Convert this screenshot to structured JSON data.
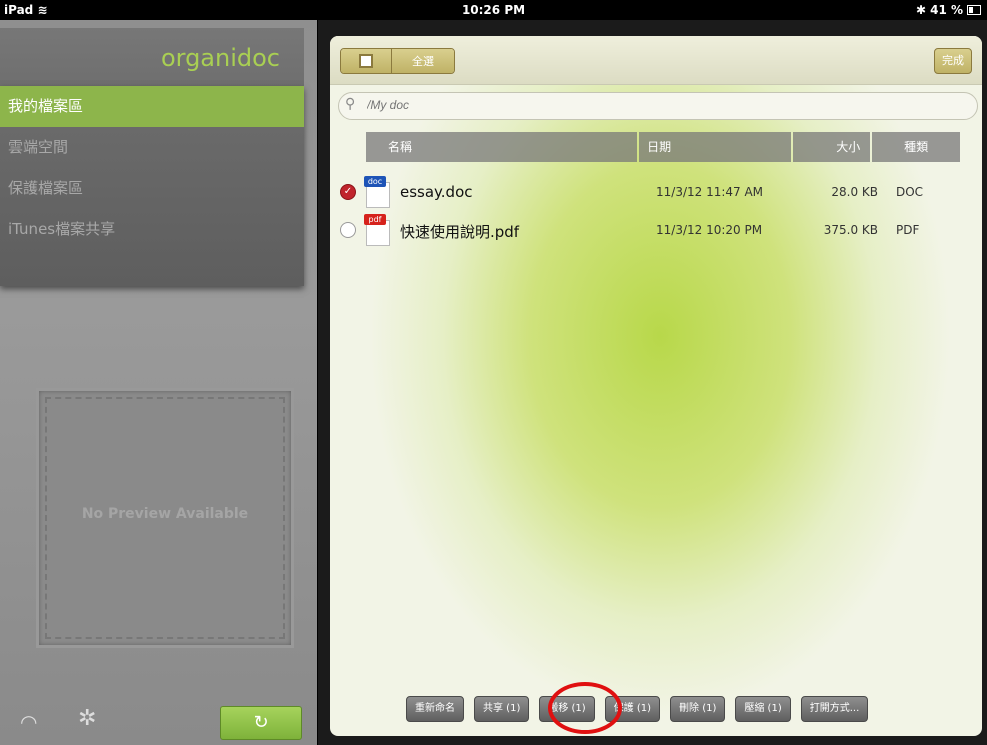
{
  "status": {
    "device": "iPad",
    "time": "10:26 PM",
    "battery": "41 %"
  },
  "sidebar": {
    "logo": "organidoc",
    "items": [
      {
        "label": "我的檔案區"
      },
      {
        "label": "雲端空間"
      },
      {
        "label": "保護檔案區"
      },
      {
        "label": "iTunes檔案共享"
      }
    ],
    "preview_text": "No Preview Available",
    "icons": [
      "wifi-icon",
      "gear-icon",
      "sync-icon"
    ]
  },
  "toolbar": {
    "select_all": "全選",
    "done": "完成"
  },
  "search": {
    "placeholder": "/My doc"
  },
  "table": {
    "headers": {
      "name": "名稱",
      "date": "日期",
      "size": "大小",
      "kind": "種類"
    },
    "rows": [
      {
        "name": "essay.doc",
        "date": "11/3/12 11:47 AM",
        "size": "28.0 KB",
        "kind": "DOC",
        "tag": "doc",
        "tag_color": "#1e54b7",
        "selected": true
      },
      {
        "name": "快速使用說明.pdf",
        "date": "11/3/12 10:20 PM",
        "size": "375.0 KB",
        "kind": "PDF",
        "tag": "pdf",
        "tag_color": "#d6221c",
        "selected": false
      }
    ]
  },
  "actions": {
    "rename": "重新命名",
    "share": "共享 (1)",
    "move": "搬移 (1)",
    "protect": "保護 (1)",
    "delete": "刪除 (1)",
    "compress": "壓縮 (1)",
    "open_with": "打開方式..."
  },
  "colors": {
    "accent_green": "#8db54b",
    "highlight_red": "#e01010"
  }
}
